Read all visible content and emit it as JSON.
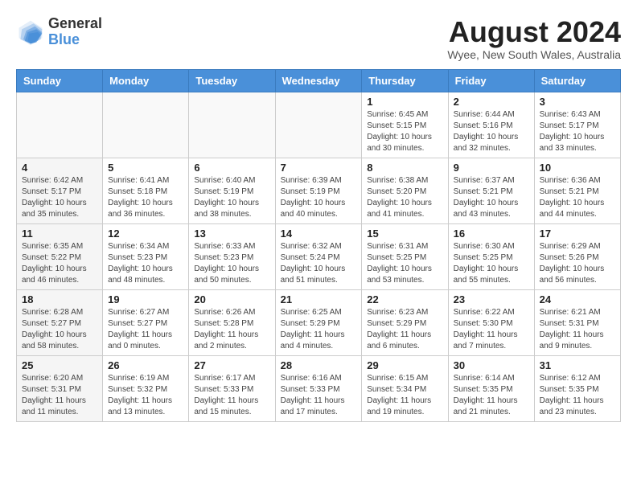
{
  "header": {
    "logo_line1": "General",
    "logo_line2": "Blue",
    "month_year": "August 2024",
    "location": "Wyee, New South Wales, Australia"
  },
  "days_of_week": [
    "Sunday",
    "Monday",
    "Tuesday",
    "Wednesday",
    "Thursday",
    "Friday",
    "Saturday"
  ],
  "weeks": [
    [
      {
        "day": "",
        "info": ""
      },
      {
        "day": "",
        "info": ""
      },
      {
        "day": "",
        "info": ""
      },
      {
        "day": "",
        "info": ""
      },
      {
        "day": "1",
        "info": "Sunrise: 6:45 AM\nSunset: 5:15 PM\nDaylight: 10 hours\nand 30 minutes."
      },
      {
        "day": "2",
        "info": "Sunrise: 6:44 AM\nSunset: 5:16 PM\nDaylight: 10 hours\nand 32 minutes."
      },
      {
        "day": "3",
        "info": "Sunrise: 6:43 AM\nSunset: 5:17 PM\nDaylight: 10 hours\nand 33 minutes."
      }
    ],
    [
      {
        "day": "4",
        "info": "Sunrise: 6:42 AM\nSunset: 5:17 PM\nDaylight: 10 hours\nand 35 minutes."
      },
      {
        "day": "5",
        "info": "Sunrise: 6:41 AM\nSunset: 5:18 PM\nDaylight: 10 hours\nand 36 minutes."
      },
      {
        "day": "6",
        "info": "Sunrise: 6:40 AM\nSunset: 5:19 PM\nDaylight: 10 hours\nand 38 minutes."
      },
      {
        "day": "7",
        "info": "Sunrise: 6:39 AM\nSunset: 5:19 PM\nDaylight: 10 hours\nand 40 minutes."
      },
      {
        "day": "8",
        "info": "Sunrise: 6:38 AM\nSunset: 5:20 PM\nDaylight: 10 hours\nand 41 minutes."
      },
      {
        "day": "9",
        "info": "Sunrise: 6:37 AM\nSunset: 5:21 PM\nDaylight: 10 hours\nand 43 minutes."
      },
      {
        "day": "10",
        "info": "Sunrise: 6:36 AM\nSunset: 5:21 PM\nDaylight: 10 hours\nand 44 minutes."
      }
    ],
    [
      {
        "day": "11",
        "info": "Sunrise: 6:35 AM\nSunset: 5:22 PM\nDaylight: 10 hours\nand 46 minutes."
      },
      {
        "day": "12",
        "info": "Sunrise: 6:34 AM\nSunset: 5:23 PM\nDaylight: 10 hours\nand 48 minutes."
      },
      {
        "day": "13",
        "info": "Sunrise: 6:33 AM\nSunset: 5:23 PM\nDaylight: 10 hours\nand 50 minutes."
      },
      {
        "day": "14",
        "info": "Sunrise: 6:32 AM\nSunset: 5:24 PM\nDaylight: 10 hours\nand 51 minutes."
      },
      {
        "day": "15",
        "info": "Sunrise: 6:31 AM\nSunset: 5:25 PM\nDaylight: 10 hours\nand 53 minutes."
      },
      {
        "day": "16",
        "info": "Sunrise: 6:30 AM\nSunset: 5:25 PM\nDaylight: 10 hours\nand 55 minutes."
      },
      {
        "day": "17",
        "info": "Sunrise: 6:29 AM\nSunset: 5:26 PM\nDaylight: 10 hours\nand 56 minutes."
      }
    ],
    [
      {
        "day": "18",
        "info": "Sunrise: 6:28 AM\nSunset: 5:27 PM\nDaylight: 10 hours\nand 58 minutes."
      },
      {
        "day": "19",
        "info": "Sunrise: 6:27 AM\nSunset: 5:27 PM\nDaylight: 11 hours\nand 0 minutes."
      },
      {
        "day": "20",
        "info": "Sunrise: 6:26 AM\nSunset: 5:28 PM\nDaylight: 11 hours\nand 2 minutes."
      },
      {
        "day": "21",
        "info": "Sunrise: 6:25 AM\nSunset: 5:29 PM\nDaylight: 11 hours\nand 4 minutes."
      },
      {
        "day": "22",
        "info": "Sunrise: 6:23 AM\nSunset: 5:29 PM\nDaylight: 11 hours\nand 6 minutes."
      },
      {
        "day": "23",
        "info": "Sunrise: 6:22 AM\nSunset: 5:30 PM\nDaylight: 11 hours\nand 7 minutes."
      },
      {
        "day": "24",
        "info": "Sunrise: 6:21 AM\nSunset: 5:31 PM\nDaylight: 11 hours\nand 9 minutes."
      }
    ],
    [
      {
        "day": "25",
        "info": "Sunrise: 6:20 AM\nSunset: 5:31 PM\nDaylight: 11 hours\nand 11 minutes."
      },
      {
        "day": "26",
        "info": "Sunrise: 6:19 AM\nSunset: 5:32 PM\nDaylight: 11 hours\nand 13 minutes."
      },
      {
        "day": "27",
        "info": "Sunrise: 6:17 AM\nSunset: 5:33 PM\nDaylight: 11 hours\nand 15 minutes."
      },
      {
        "day": "28",
        "info": "Sunrise: 6:16 AM\nSunset: 5:33 PM\nDaylight: 11 hours\nand 17 minutes."
      },
      {
        "day": "29",
        "info": "Sunrise: 6:15 AM\nSunset: 5:34 PM\nDaylight: 11 hours\nand 19 minutes."
      },
      {
        "day": "30",
        "info": "Sunrise: 6:14 AM\nSunset: 5:35 PM\nDaylight: 11 hours\nand 21 minutes."
      },
      {
        "day": "31",
        "info": "Sunrise: 6:12 AM\nSunset: 5:35 PM\nDaylight: 11 hours\nand 23 minutes."
      }
    ]
  ]
}
